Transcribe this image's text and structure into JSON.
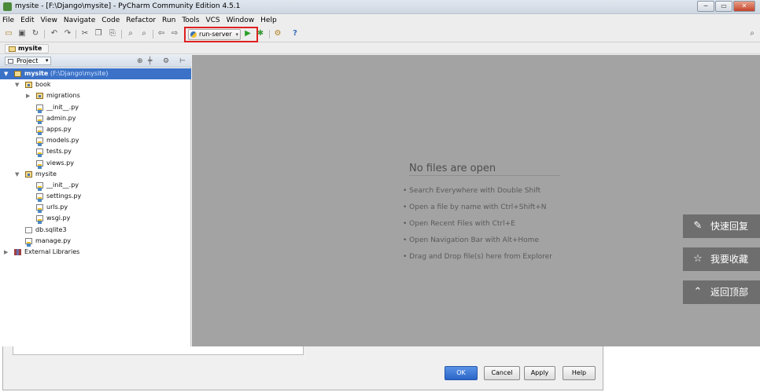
{
  "window": {
    "title": "mysite - [F:\\Django\\mysite] - PyCharm Community Edition 4.5.1"
  },
  "menu": [
    "File",
    "Edit",
    "View",
    "Navigate",
    "Code",
    "Refactor",
    "Run",
    "Tools",
    "VCS",
    "Window",
    "Help"
  ],
  "toolbar": {
    "run_config": "run-server"
  },
  "breadcrumb": "mysite",
  "panel": {
    "title": "Project"
  },
  "tree": {
    "root_label": "mysite",
    "root_path": "(F:\\Django\\mysite)",
    "items": [
      "book",
      "migrations",
      "__init__.py",
      "admin.py",
      "apps.py",
      "models.py",
      "tests.py",
      "views.py",
      "mysite",
      "__init__.py",
      "settings.py",
      "urls.py",
      "wsgi.py",
      "db.sqlite3",
      "manage.py",
      "External Libraries"
    ]
  },
  "editor": {
    "empty_title": "No files are open",
    "hints": [
      "• Search Everywhere with Double Shift",
      "• Open a file by name with Ctrl+Shift+N",
      "• Open Recent Files with Ctrl+E",
      "• Open Navigation Bar with Alt+Home",
      "• Drag and Drop file(s) here from Explorer"
    ]
  },
  "dialog": {
    "ok": "OK",
    "cancel": "Cancel",
    "apply": "Apply",
    "help": "Help"
  },
  "floating": {
    "reply": "快速回复",
    "favorite": "我要收藏",
    "top": "返回顶部"
  }
}
